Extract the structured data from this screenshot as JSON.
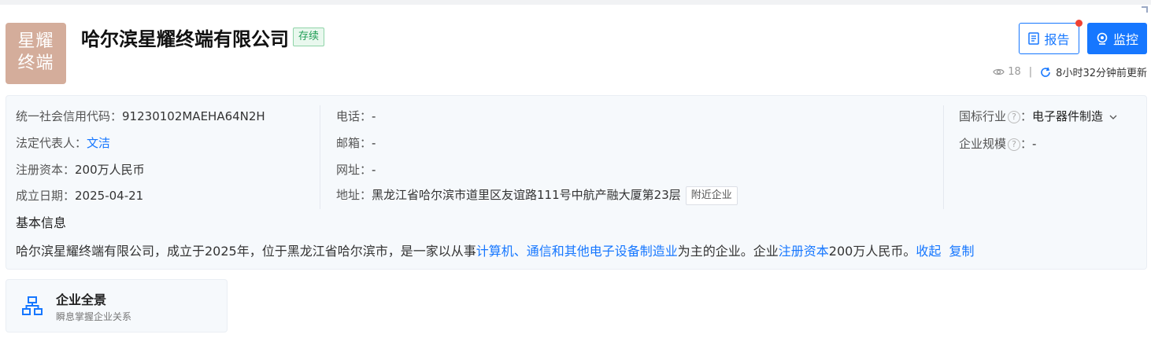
{
  "company": {
    "logo_text": "星耀\n终端",
    "name": "哈尔滨星耀终端有限公司",
    "status": "存续"
  },
  "actions": {
    "report_label": "报告",
    "monitor_label": "监控",
    "views": "18",
    "updated": "8小时32分钟前更新"
  },
  "info": {
    "credit_code_label": "统一社会信用代码：",
    "credit_code": "91230102MAEHA64N2H",
    "legal_rep_label": "法定代表人：",
    "legal_rep": "文洁",
    "reg_capital_label": "注册资本：",
    "reg_capital": "200万人民币",
    "founded_label": "成立日期：",
    "founded": "2025-04-21",
    "phone_label": "电话：",
    "phone": "-",
    "email_label": "邮箱：",
    "email": "-",
    "website_label": "网址：",
    "website": "-",
    "address_label": "地址：",
    "address": "黑龙江省哈尔滨市道里区友谊路111号中航产融大厦第23层",
    "nearby_label": "附近企业",
    "industry_label": "国标行业",
    "industry": "电子器件制造",
    "scale_label": "企业规模",
    "scale": "-",
    "colon": "："
  },
  "summary": {
    "title": "基本信息",
    "part1": "哈尔滨星耀终端有限公司，成立于2025年，位于黑龙江省哈尔滨市，是一家以从事",
    "industry_link": "计算机、通信和其他电子设备制造业",
    "part2": "为主的企业。企业",
    "capital_link": "注册资本",
    "part3": "200万人民币。",
    "collapse": "收起",
    "copy": "复制"
  },
  "panorama": {
    "title": "企业全景",
    "subtitle": "瞬息掌握企业关系"
  },
  "colors": {
    "accent": "#1677ff",
    "logo_bg": "#d4ad9b",
    "status_green": "#1f9d55"
  }
}
